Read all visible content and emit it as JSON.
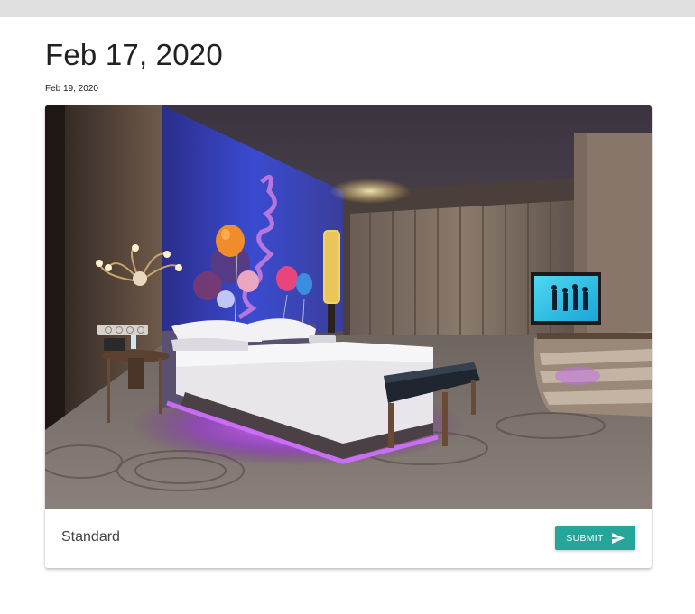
{
  "header": {
    "title": "Feb 17, 2020",
    "subdate": "Feb 19, 2020"
  },
  "card": {
    "image_icon": "hotel-room-photo",
    "label": "Standard",
    "submit_label": "SUBMIT",
    "submit_icon": "send-icon"
  },
  "colors": {
    "topbar": "#e0e0e0",
    "button": "#26a69a",
    "title_text": "#212121"
  }
}
